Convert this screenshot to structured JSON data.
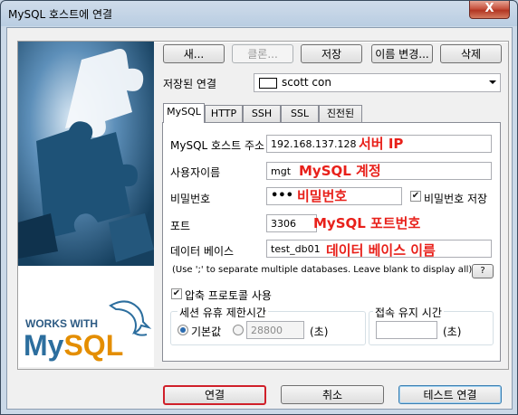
{
  "window": {
    "title": "MySQL 호스트에 연결",
    "close_glyph": "X"
  },
  "toolbar": {
    "new": "새...",
    "clone": "클론...",
    "save": "저장",
    "rename": "이름 변경...",
    "delete": "삭제"
  },
  "saved_connection": {
    "label": "저장된 연결",
    "value": "scott con"
  },
  "tabs": [
    "MySQL",
    "HTTP",
    "SSH",
    "SSL",
    "진전된"
  ],
  "form": {
    "host_label": "MySQL 호스트 주소",
    "host_value": "192.168.137.128",
    "host_note": "서버 IP",
    "user_label": "사용자이름",
    "user_value": "mgt",
    "user_note": "MySQL 계정",
    "password_label": "비밀번호",
    "password_value": "•••",
    "password_note": "비밀번호",
    "save_password_label": "비밀번호 저장",
    "port_label": "포트",
    "port_value": "3306",
    "port_note": "MySQL 포트번호",
    "database_label": "데이터 베이스",
    "database_value": "test_db01",
    "database_note": "데이터 베이스 이름",
    "database_hint": "(Use ';' to separate multiple databases. Leave blank to display all)",
    "help_label": "?",
    "compress_label": "압축 프로토콜 사용",
    "session_group_label": "세션 유휴 제한시간",
    "default_label": "기본값",
    "timeout_value": "28800",
    "seconds_label": "(초)",
    "keepalive_group_label": "접속 유지 시간",
    "keepalive_value": "",
    "keepalive_seconds_label": "(초)"
  },
  "footer": {
    "connect": "연결",
    "cancel": "취소",
    "test": "테스트 연결"
  },
  "branding": {
    "works_with": "WORKS WITH",
    "logo_my": "My",
    "logo_sql": "SQL"
  },
  "colors": {
    "annotation": "#e8201a",
    "highlight_border": "#d0202a",
    "logo_blue": "#2c6e9e",
    "logo_orange": "#e48e00"
  }
}
